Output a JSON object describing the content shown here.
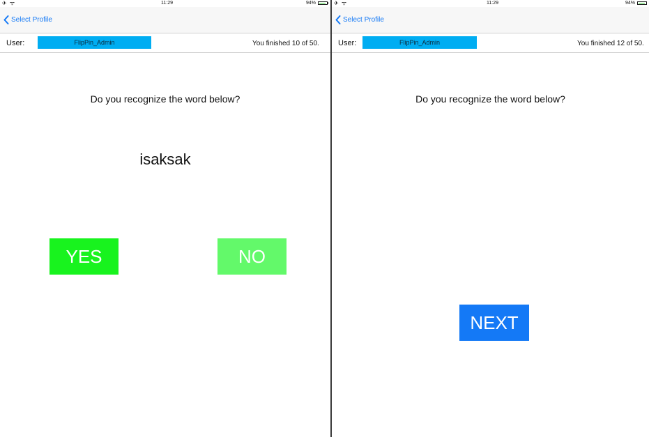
{
  "status_bar": {
    "signal_text": "✈ ᯤ",
    "time": "11:29",
    "battery_percent": "94%",
    "battery_level": 0.94
  },
  "left_screen": {
    "nav": {
      "back_label": "Select Profile"
    },
    "user": {
      "label": "User:",
      "name": "FlipPin_Admin",
      "progress": "You finished 10 of 50."
    },
    "question": "Do you recognize the word below?",
    "word": "isaksak",
    "yes_label": "YES",
    "no_label": "NO"
  },
  "right_screen": {
    "nav": {
      "back_label": "Select Profile"
    },
    "user": {
      "label": "User:",
      "name": "FlipPin_Admin",
      "progress": "You finished 12 of 50."
    },
    "question": "Do you recognize the word below?",
    "next_label": "NEXT"
  },
  "colors": {
    "ios_blue": "#1479f6",
    "user_badge": "#00adf2",
    "yes_green": "#18f31e",
    "no_green": "#63f96a"
  }
}
